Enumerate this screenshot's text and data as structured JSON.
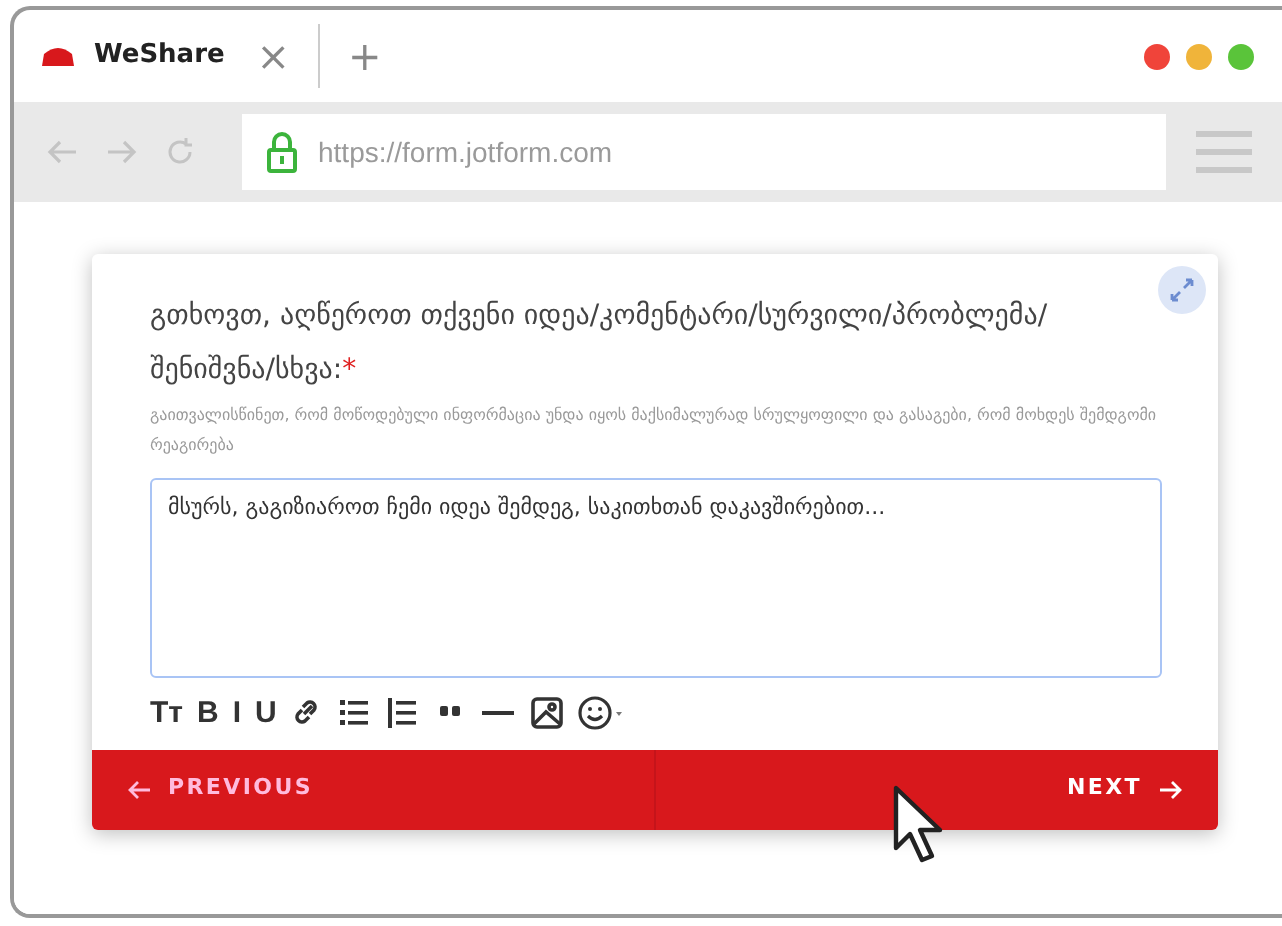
{
  "browser": {
    "tab": {
      "title": "WeShare",
      "close": "×"
    },
    "new_tab": "+",
    "window_dots": [
      {
        "color": "#f0443a"
      },
      {
        "color": "#f0b43a"
      },
      {
        "color": "#5ac43a"
      }
    ],
    "url": "https://form.jotform.com"
  },
  "form": {
    "question": "გთხოვთ, აღწეროთ თქვენი იდეა/კომენტარი/სურვილი/პრობლემა/შენიშვნა/სხვა:",
    "required_mark": "*",
    "hint": "გაითვალისწინეთ, რომ მოწოდებული ინფორმაცია უნდა იყოს მაქსიმალურად სრულყოფილი და გასაგები, რომ მოხდეს შემდგომი რეაგირება",
    "answer": "მსურს, გაგიზიაროთ ჩემი იდეა შემდეგ, საკითხთან დაკავშირებით...",
    "toolbar": [
      {
        "kind": "text",
        "label": "Tт"
      },
      {
        "kind": "text",
        "label": "B"
      },
      {
        "kind": "text",
        "label": "I"
      },
      {
        "kind": "text",
        "label": "U"
      },
      {
        "kind": "link"
      },
      {
        "kind": "bullets"
      },
      {
        "kind": "numbers"
      },
      {
        "kind": "quote"
      },
      {
        "kind": "rule"
      },
      {
        "kind": "image"
      },
      {
        "kind": "emoji"
      }
    ],
    "buttons": [
      {
        "kind": "previous",
        "label": "PREVIOUS"
      },
      {
        "kind": "next",
        "label": "NEXT"
      }
    ]
  }
}
